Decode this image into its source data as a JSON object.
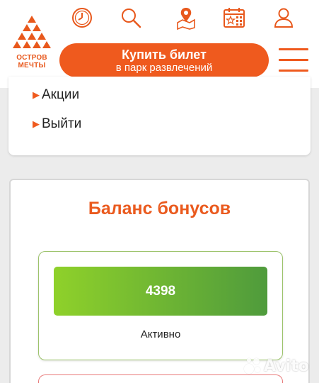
{
  "header": {
    "logo_text_line1": "ОСТРОВ",
    "logo_text_line2": "МЕЧТЫ",
    "icons": [
      "clock-icon",
      "search-icon",
      "map-pin-icon",
      "calendar-icon",
      "user-icon"
    ],
    "buy_button": {
      "line1": "Купить билет",
      "line2": "в парк развлечений"
    }
  },
  "menu": {
    "items": [
      {
        "label": "Акции"
      },
      {
        "label": "Выйти"
      }
    ]
  },
  "bonus": {
    "title": "Баланс бонусов",
    "balance": "4398",
    "status": "Активно"
  },
  "watermark": {
    "text": "Avito"
  },
  "colors": {
    "accent": "#ef5a1e",
    "balance_gradient_start": "#8fd12a",
    "balance_gradient_end": "#4f9b3c",
    "card_border_green": "#9cc36b",
    "card_border_red": "#e87a7a"
  }
}
